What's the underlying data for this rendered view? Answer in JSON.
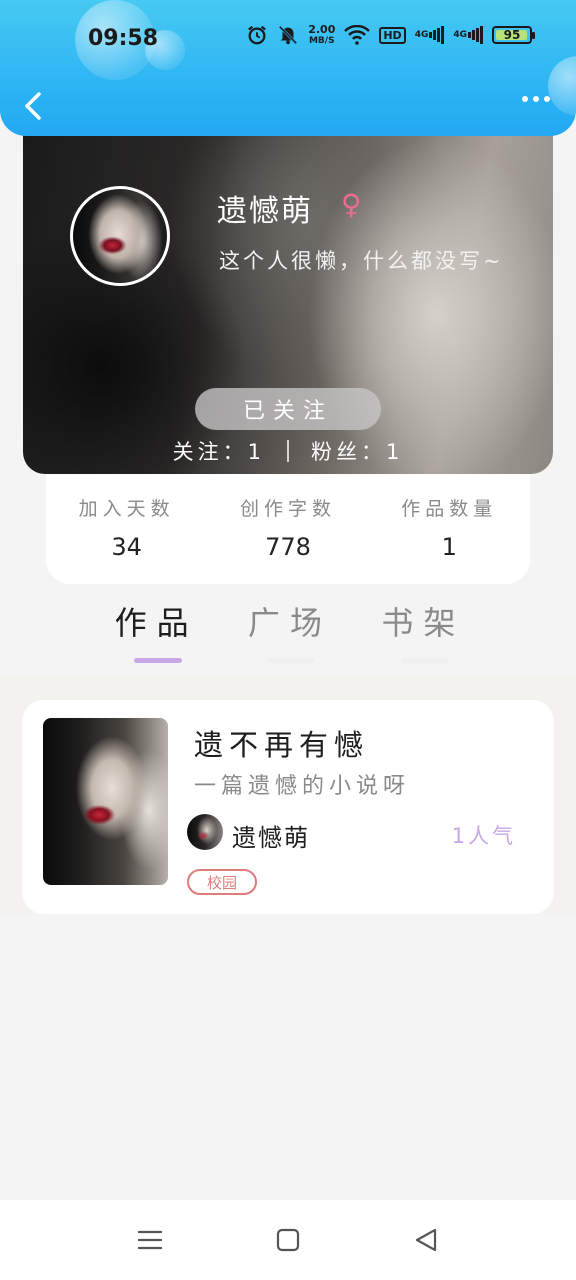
{
  "status_bar": {
    "time": "09:58",
    "net_speed_value": "2.00",
    "net_speed_unit": "MB/S",
    "hd_label": "HD",
    "sim1_label": "4G",
    "sim2_label": "4G",
    "battery_level": "95",
    "icons": [
      "alarm-icon",
      "mute-icon",
      "wifi-icon",
      "hd-icon",
      "signal-icon",
      "signal-icon",
      "battery-icon"
    ]
  },
  "header": {
    "back_icon": "chevron-left-icon",
    "more_icon": "more-horizontal-icon",
    "background_color": "#2ab2f4"
  },
  "profile": {
    "nickname": "遗憾萌",
    "gender_symbol": "♀",
    "bio": "这个人很懒，什么都没写~",
    "follow_button_label": "已关注",
    "following_label": "关注：",
    "following_count": "1",
    "followers_label": "粉丝：",
    "followers_count": "1"
  },
  "stats": [
    {
      "label": "加入天数",
      "value": "34"
    },
    {
      "label": "创作字数",
      "value": "778"
    },
    {
      "label": "作品数量",
      "value": "1"
    }
  ],
  "tabs": [
    {
      "label": "作品",
      "active": true
    },
    {
      "label": "广场",
      "active": false
    },
    {
      "label": "书架",
      "active": false
    }
  ],
  "works": [
    {
      "title": "遗不再有憾",
      "description": "一篇遗憾的小说呀",
      "author": "遗憾萌",
      "popularity": "1人气",
      "tag": "校园"
    }
  ],
  "navbar": {
    "icons": [
      "menu-icon",
      "home-square-icon",
      "back-triangle-icon"
    ]
  },
  "colors": {
    "accent_purple": "#c8a7e6",
    "tag_red": "#e07c7c",
    "gender_pink": "#ec6d8f"
  }
}
